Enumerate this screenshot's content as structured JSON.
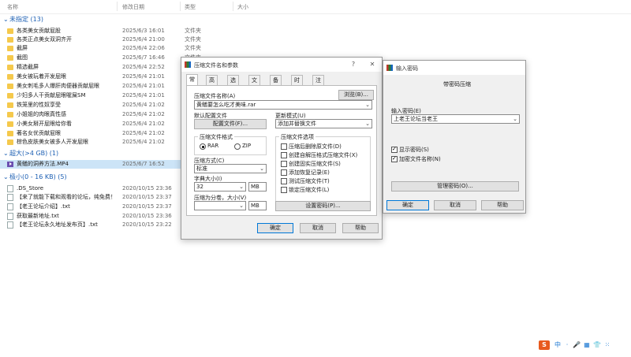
{
  "explorer": {
    "columns": {
      "name": "名称",
      "date": "修改日期",
      "type": "类型",
      "size": "大小"
    },
    "groups": [
      {
        "label": "未指定 (13)"
      },
      {
        "label": "超大(>4 GB) (1)"
      },
      {
        "label": "极小(0 - 16 KB) (5)"
      }
    ],
    "folders": [
      {
        "name": "各类美女贡献屁股",
        "date": "2025/6/3 16:01",
        "type": "文件夹"
      },
      {
        "name": "各类正点美女双洞齐开",
        "date": "2025/6/4 21:00",
        "type": "文件夹"
      },
      {
        "name": "截屏",
        "date": "2025/6/4 22:06",
        "type": "文件夹"
      },
      {
        "name": "截图",
        "date": "2025/6/7 16:46",
        "type": "文件夹"
      },
      {
        "name": "精选截屏",
        "date": "2025/6/4 22:52",
        "type": "文件夹"
      },
      {
        "name": "美女被玩着开发屁眼",
        "date": "2025/6/4 21:01",
        "type": "文件夹"
      },
      {
        "name": "美女刺毛多人爆肝肉便器贡献屁眼",
        "date": "2025/6/4 21:01",
        "type": "文件夹"
      },
      {
        "name": "少妇多人干贡献屁眼喔屎SM",
        "date": "2025/6/4 21:01",
        "type": "文件夹"
      },
      {
        "name": "铁笼里的性奴享受",
        "date": "2025/6/4 21:02",
        "type": "文件夹"
      },
      {
        "name": "小姐姐的肉眼真性感",
        "date": "2025/6/4 21:02",
        "type": "文件夹"
      },
      {
        "name": "小美女掰开屁眼给你看",
        "date": "2025/6/4 21:02",
        "type": "文件夹"
      },
      {
        "name": "著名女优贡献屁眼",
        "date": "2025/6/4 21:02",
        "type": "文件夹"
      },
      {
        "name": "棕色皮肤美女被多人开发屁眼",
        "date": "2025/6/4 21:02",
        "type": "文件夹"
      }
    ],
    "large_files": [
      {
        "name": "黄鳝的洞养方法.MP4",
        "date": "2025/6/7 16:52",
        "type": "MP4 文件"
      }
    ],
    "small_files": [
      {
        "name": ".DS_Store",
        "date": "2020/10/15 23:36"
      },
      {
        "name": "【来了就能下载和观看的论坛，纯免费！",
        "date": "2020/10/15 23:37"
      },
      {
        "name": "【老王论坛介绍】.txt",
        "date": "2020/10/15 23:37"
      },
      {
        "name": "获取最新地址.txt",
        "date": "2020/10/15 23:36"
      },
      {
        "name": "【老王论坛永久地址发布页】.txt",
        "date": "2020/10/15 23:22"
      }
    ]
  },
  "archive_dialog": {
    "title": "压缩文件名和参数",
    "help_btn": "?",
    "close_btn": "✕",
    "tabs": [
      "常规",
      "高级",
      "选项",
      "文件",
      "备份",
      "时间",
      "注释"
    ],
    "filename_label": "压缩文件名称(A)",
    "browse_btn": "浏览(B)...",
    "filename_value": "黄鳝要怎么吃才美味.rar",
    "profile_label": "默认配置文件",
    "profile_btn": "配置文件(F)...",
    "update_label": "更新模式(U)",
    "update_value": "添加并替换文件",
    "format_label": "压缩文件格式",
    "format_rar": "RAR",
    "format_zip": "ZIP",
    "method_label": "压缩方式(C)",
    "method_value": "标准",
    "dict_label": "字典大小(I)",
    "dict_value": "32",
    "dict_unit": "MB",
    "split_label": "压缩为分卷，大小(V)",
    "split_unit": "MB",
    "options_label": "压缩文件选项",
    "options": [
      {
        "label": "压缩后删除原文件(D)",
        "checked": false
      },
      {
        "label": "创建自解压格式压缩文件(X)",
        "checked": false
      },
      {
        "label": "创建固实压缩文件(S)",
        "checked": false
      },
      {
        "label": "添加恢复记录(E)",
        "checked": false
      },
      {
        "label": "测试压缩文件(T)",
        "checked": false
      },
      {
        "label": "锁定压缩文件(L)",
        "checked": false
      }
    ],
    "password_btn": "设置密码(P)...",
    "ok_btn": "确定",
    "cancel_btn": "取消",
    "help_label": "帮助"
  },
  "password_dialog": {
    "title": "输入密码",
    "heading": "带密码压缩",
    "input_label": "输入密码(E)",
    "input_value": "上老王论坛当老王",
    "show_password": "显示密码(S)",
    "encrypt_names": "加密文件名称(N)",
    "manage_btn": "管理密码(O)...",
    "ok_btn": "确定",
    "cancel_btn": "取消",
    "help_btn": "帮助"
  },
  "tray": {
    "ime": "中",
    "punct": "·",
    "voice": "🎤",
    "keyboard": "▦",
    "shirt": "👕",
    "grid": "⁙"
  }
}
